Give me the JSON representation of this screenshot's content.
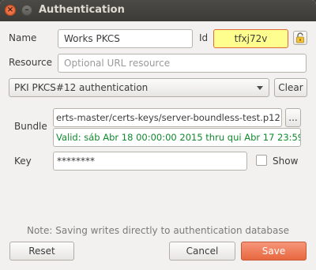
{
  "window": {
    "title": "Authentication"
  },
  "form": {
    "name_label": "Name",
    "name_value": "Works PKCS",
    "id_label": "Id",
    "id_value": "tfxj72v",
    "resource_label": "Resource",
    "resource_placeholder": "Optional URL resource",
    "method_value": "PKI PKCS#12 authentication",
    "clear_label": "Clear",
    "bundle_label": "Bundle",
    "bundle_path": "erts-master/certs-keys/server-boundless-test.p12",
    "browse_label": "...",
    "bundle_validity": "Valid: sáb Abr 18 00:00:00 2015 thru qui Abr 17 23:59:",
    "key_label": "Key",
    "key_value": "********",
    "show_label": "Show"
  },
  "footer": {
    "note": "Note: Saving writes directly to authentication database",
    "reset_label": "Reset",
    "cancel_label": "Cancel",
    "save_label": "Save"
  },
  "colors": {
    "accent": "#e8683f",
    "valid": "#0f8a2c",
    "id_highlight": "#fefe8f",
    "titlebar": "#3c3b37"
  },
  "icons": {
    "close": "close-icon",
    "minimize": "minimize-icon",
    "lock": "lock-icon",
    "dropdown": "chevron-down-icon"
  }
}
